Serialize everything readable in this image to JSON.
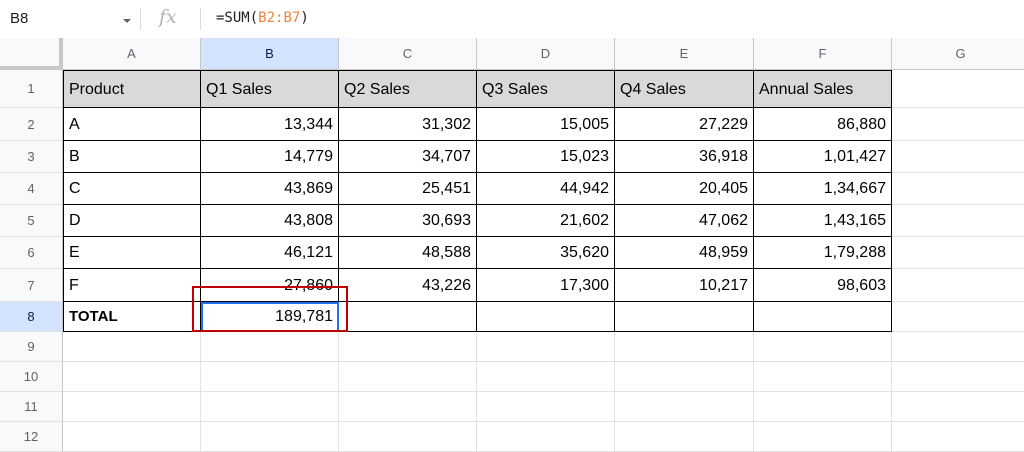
{
  "formula_bar": {
    "name_box": "B8",
    "fx_label": "fx",
    "formula_prefix": "=SUM(",
    "formula_range": "B2:B7",
    "formula_suffix": ")"
  },
  "columns": [
    "A",
    "B",
    "C",
    "D",
    "E",
    "F",
    "G"
  ],
  "rows": [
    "1",
    "2",
    "3",
    "4",
    "5",
    "6",
    "7",
    "8",
    "9",
    "10",
    "11",
    "12"
  ],
  "selected_cell": "B8",
  "table": {
    "headers": [
      "Product",
      "Q1 Sales",
      "Q2 Sales",
      "Q3 Sales",
      "Q4 Sales",
      "Annual Sales"
    ],
    "data": [
      [
        "A",
        "13,344",
        "31,302",
        "15,005",
        "27,229",
        "86,880"
      ],
      [
        "B",
        "14,779",
        "34,707",
        "15,023",
        "36,918",
        "1,01,427"
      ],
      [
        "C",
        "43,869",
        "25,451",
        "44,942",
        "20,405",
        "1,34,667"
      ],
      [
        "D",
        "43,808",
        "30,693",
        "21,602",
        "47,062",
        "1,43,165"
      ],
      [
        "E",
        "46,121",
        "48,588",
        "35,620",
        "48,959",
        "1,79,288"
      ],
      [
        "F",
        "27,860",
        "43,226",
        "17,300",
        "10,217",
        "98,603"
      ]
    ],
    "total_row": [
      "TOTAL",
      "189,781",
      "",
      "",
      "",
      ""
    ]
  },
  "colors": {
    "highlight_box": "#c00000",
    "active_cell": "#1a73e8",
    "header_fill": "#d9d9d9",
    "formula_ref": "#e8863a"
  }
}
